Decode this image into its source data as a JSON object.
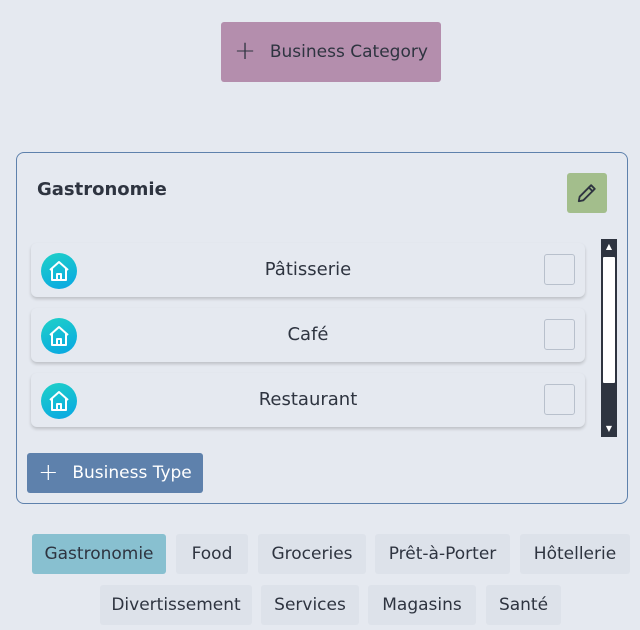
{
  "header": {
    "add_category_label": "Business Category"
  },
  "category_card": {
    "title": "Gastronomie",
    "types": [
      {
        "label": "Pâtisserie",
        "icon": "home-icon",
        "checked": false
      },
      {
        "label": "Café",
        "icon": "home-icon",
        "checked": false
      },
      {
        "label": "Restaurant",
        "icon": "home-icon",
        "checked": false
      }
    ],
    "add_type_label": "Business Type"
  },
  "category_chips": [
    {
      "label": "Gastronomie",
      "active": true
    },
    {
      "label": "Food",
      "active": false
    },
    {
      "label": "Groceries",
      "active": false
    },
    {
      "label": "Prêt-à-Porter",
      "active": false
    },
    {
      "label": "Hôtellerie",
      "active": false
    },
    {
      "label": "Divertissement",
      "active": false
    },
    {
      "label": "Services",
      "active": false
    },
    {
      "label": "Magasins",
      "active": false
    },
    {
      "label": "Santé",
      "active": false
    }
  ],
  "colors": {
    "background": "#e5e9f0",
    "category_button": "#b48ead",
    "edit_button": "#a3be8c",
    "type_button": "#5e81ac",
    "active_chip": "#88c0d0",
    "chip": "#dde2ea"
  }
}
